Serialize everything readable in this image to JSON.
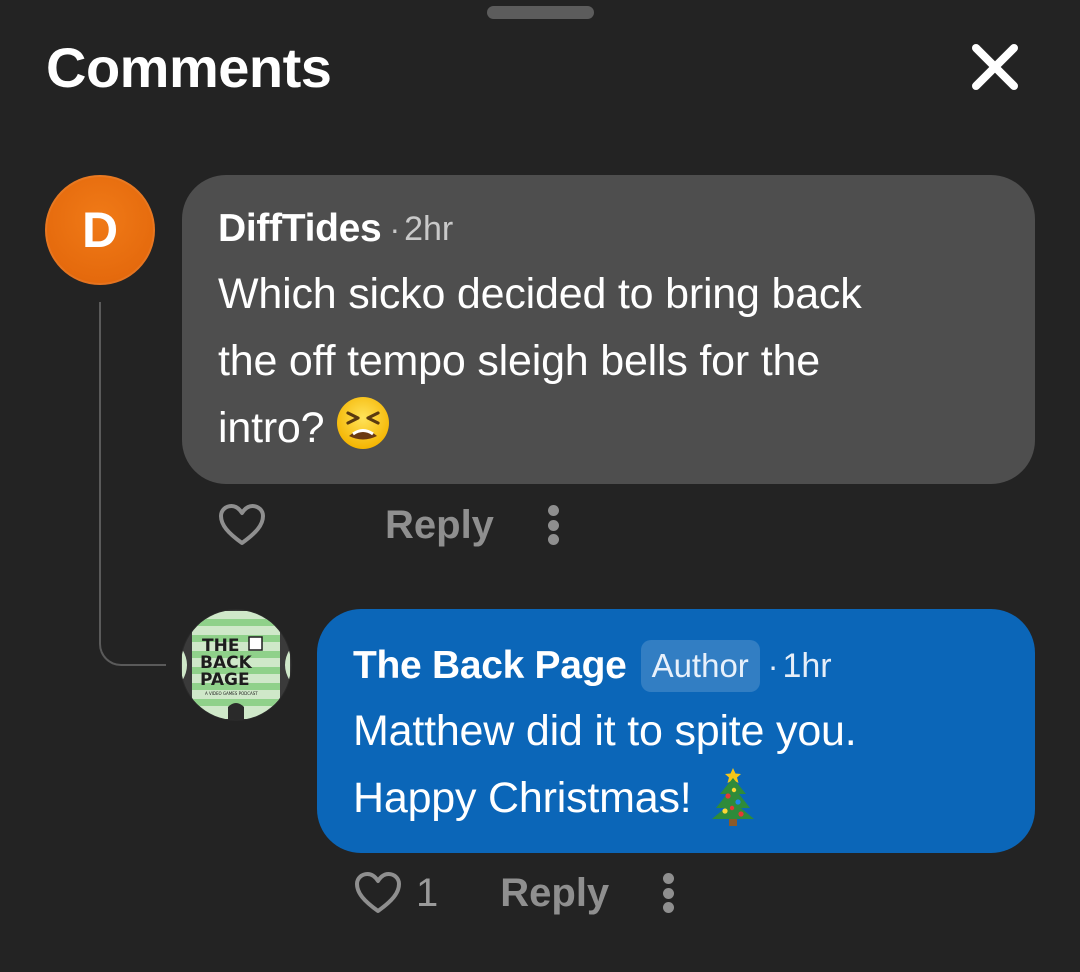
{
  "sheet": {
    "title": "Comments",
    "close_icon": "close-icon"
  },
  "comments": [
    {
      "avatar_letter": "D",
      "avatar_color": "#e8700f",
      "author": "DiffTides",
      "separator": "·",
      "time": "2hr",
      "lines": [
        "Which sicko decided to bring back",
        "the off tempo sleigh bells for the",
        "intro?"
      ],
      "emoji": "tired-face-emoji",
      "like_icon": "heart-icon",
      "like_count": "",
      "reply_label": "Reply",
      "more_icon": "more-vertical-icon",
      "bubble_color": "#4e4e4e"
    },
    {
      "avatar": "the-back-page-logo",
      "avatar_text": [
        "THE",
        "BACK",
        "PAGE",
        "A VIDEO GAMES PODCAST"
      ],
      "author": "The Back Page",
      "badge": "Author",
      "separator": "·",
      "time": "1hr",
      "lines": [
        "Matthew did it to spite you.",
        "Happy Christmas!"
      ],
      "emoji": "christmas-tree-emoji",
      "like_icon": "heart-icon",
      "like_count": "1",
      "reply_label": "Reply",
      "more_icon": "more-vertical-icon",
      "bubble_color": "#0b66b8"
    }
  ]
}
